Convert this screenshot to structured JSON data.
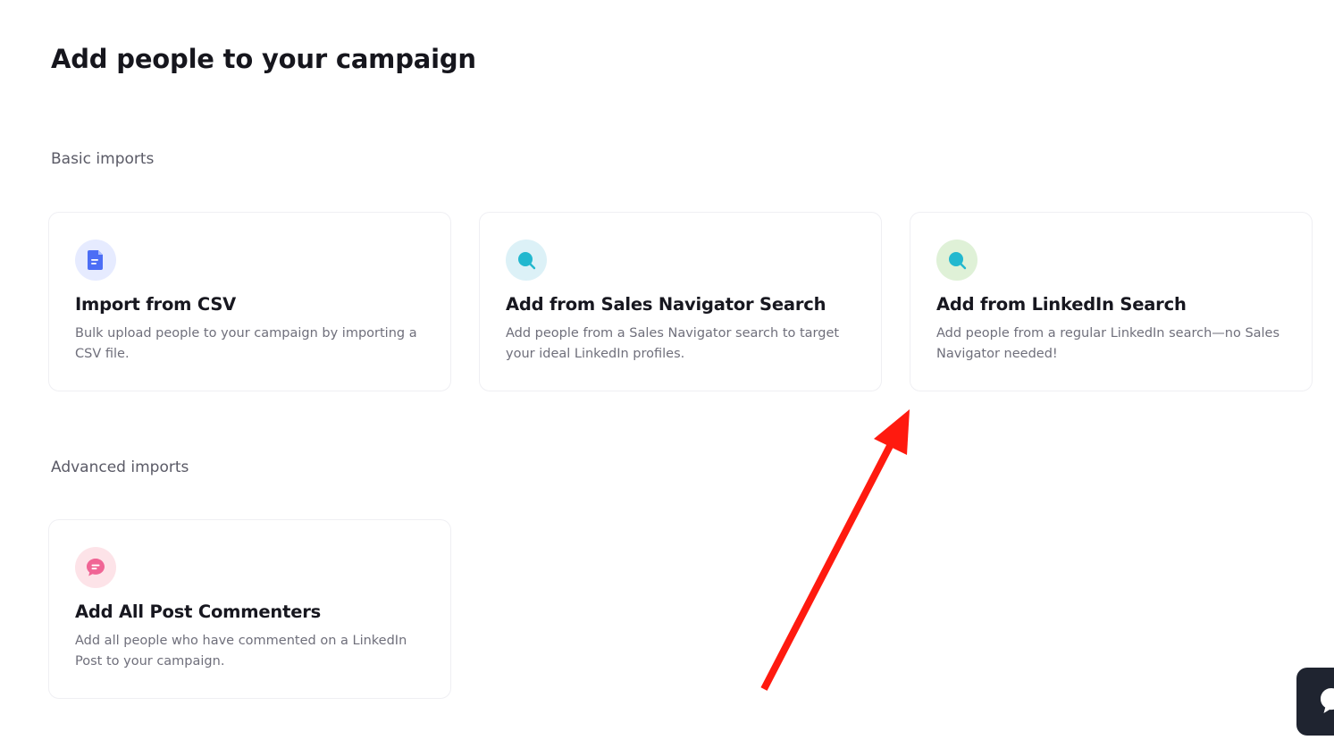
{
  "page": {
    "title": "Add people to your campaign"
  },
  "sections": {
    "basic": {
      "title": "Basic imports",
      "cards": [
        {
          "title": "Import from CSV",
          "description": "Bulk upload people to your campaign by importing a CSV file.",
          "icon": "document-icon",
          "icon_bg": "#e6ebff",
          "icon_color": "#4c6ef5"
        },
        {
          "title": "Add from Sales Navigator Search",
          "description": "Add people from a Sales Navigator search to target your ideal LinkedIn profiles.",
          "icon": "search-icon",
          "icon_bg": "#dcf1f7",
          "icon_color": "#22b8cf"
        },
        {
          "title": "Add from LinkedIn Search",
          "description": "Add people from a regular LinkedIn search—no Sales Navigator needed!",
          "icon": "search-icon",
          "icon_bg": "#dff1d7",
          "icon_color": "#22b8cf"
        }
      ]
    },
    "advanced": {
      "title": "Advanced imports",
      "cards": [
        {
          "title": "Add All Post Commenters",
          "description": "Add all people who have commented on a LinkedIn Post to your campaign.",
          "icon": "comment-icon",
          "icon_bg": "#fde3e8",
          "icon_color": "#f06595"
        }
      ]
    }
  },
  "annotation": {
    "arrow_color": "#ff1a0f",
    "arrow_target": "Add from LinkedIn Search"
  },
  "chat_widget": {
    "icon": "chat-bubble-icon",
    "bg": "#1f2430"
  }
}
